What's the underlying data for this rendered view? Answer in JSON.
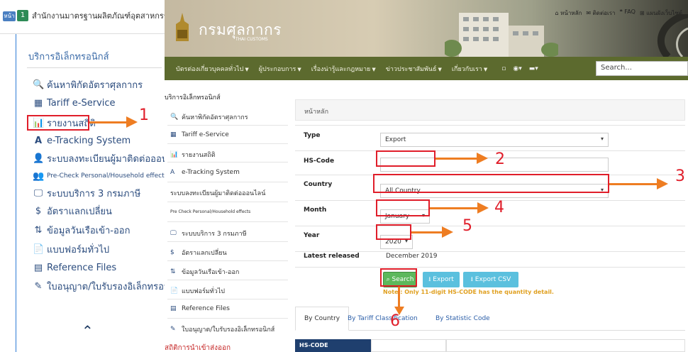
{
  "left_panel": {
    "home_chip": "หน้า",
    "num_chip": "1",
    "breadcrumb": "สำนักงานมาตรฐานผลิตภัณฑ์อุตสาหกรรม",
    "menu_title": "บริการอิเล็กทรอนิกส์",
    "items": [
      {
        "icon": "search-icon",
        "glyph": "🔍",
        "label": "ค้นหาพิกัดอัตราศุลกากร"
      },
      {
        "icon": "table-icon",
        "glyph": "▦",
        "label": "Tariff e-Service"
      },
      {
        "icon": "bar-chart-icon",
        "glyph": "📊",
        "label": "รายงานสถิติ"
      },
      {
        "icon": "tracking-icon",
        "glyph": "A",
        "label": "e-Tracking System"
      },
      {
        "icon": "user-register-icon",
        "glyph": "👤",
        "label": "ระบบลงทะเบียนผู้มาติดต่อออนไลน์"
      },
      {
        "icon": "personal-effects-icon",
        "glyph": "👥",
        "label": "Pre-Check Personal/Household effects"
      },
      {
        "icon": "monitor-icon",
        "glyph": "🖵",
        "label": "ระบบบริการ 3 กรมภาษี"
      },
      {
        "icon": "dollar-icon",
        "glyph": "$",
        "label": "อัตราแลกเปลี่ยน"
      },
      {
        "icon": "sort-icon",
        "glyph": "⇅",
        "label": "ข้อมูลวันเรือเข้า-ออก"
      },
      {
        "icon": "forms-icon",
        "glyph": "📄",
        "label": "แบบฟอร์มทั่วไป"
      },
      {
        "icon": "reference-icon",
        "glyph": "▤",
        "label": "Reference Files"
      },
      {
        "icon": "license-icon",
        "glyph": "✎",
        "label": "ใบอนุญาต/ใบรับรองอิเล็กทรอนิกส์"
      }
    ],
    "scroll_up": "⌃"
  },
  "site": {
    "logo_text": "กรมศุลกากร",
    "logo_sub": "THAI CUSTOMS",
    "top_links": [
      "หน้าหลัก",
      "ติดต่อเรา",
      "FAQ",
      "แผนผังเว็บไซต์"
    ],
    "nav_items": [
      "บัตรต่องเกี่ยวบุคคลทั่วไป",
      "ผู้ประกอบการ",
      "เรื่องน่ารู้และกฎหมาย",
      "ข่าวประชาสัมพันธ์",
      "เกี่ยวกับเรา"
    ],
    "search_placeholder": "Search...",
    "sidebar_title": "บริการอิเล็กทรอนิกส์",
    "sidebar_items": [
      {
        "glyph": "🔍",
        "label": "ค้นหาพิกัดอัตราศุลกากร"
      },
      {
        "glyph": "▦",
        "label": "Tariff e-Service"
      },
      {
        "glyph": "📊",
        "label": "รายงานสถิติ"
      },
      {
        "glyph": "A",
        "label": "e-Tracking System"
      },
      {
        "glyph": "",
        "label": "ระบบลงทะเบียนผู้มาติดต่อออนไลน์"
      },
      {
        "glyph": "",
        "label": "Pre Check Personal/Household effects"
      },
      {
        "glyph": "🖵",
        "label": "ระบบบริการ 3 กรมภาษี"
      },
      {
        "glyph": "$",
        "label": "อัตราแลกเปลี่ยน"
      },
      {
        "glyph": "⇅",
        "label": "ข้อมูลวันเรือเข้า-ออก"
      },
      {
        "glyph": "📄",
        "label": "แบบฟอร์มทั่วไป"
      },
      {
        "glyph": "▤",
        "label": "Reference Files"
      },
      {
        "glyph": "✎",
        "label": "ใบอนุญาต/ใบรับรองอิเล็กทรอนิกส์"
      }
    ],
    "sidebar_bottom": "สถิติการนำเข้าส่งออก",
    "crumb": "หน้าหลัก",
    "form": {
      "type_label": "Type",
      "type_value": "Export",
      "hs_label": "HS-Code",
      "hs_value": "",
      "country_label": "Country",
      "country_value": "All Country",
      "month_label": "Month",
      "month_value": "January",
      "year_label": "Year",
      "year_value": "2020",
      "latest_label": "Latest released",
      "latest_value": "December 2019"
    },
    "buttons": {
      "search": "Search",
      "export": "Export",
      "csv": "Export CSV"
    },
    "note": "Note : Only 11-digit HS-CODE has the quantity detail.",
    "tabs": [
      "By Country",
      "By Tariff Classification",
      "By Statistic Code"
    ],
    "table_header": "HS-CODE"
  },
  "annotations": [
    "1",
    "2",
    "3",
    "4",
    "5",
    "6"
  ],
  "colors": {
    "highlight": "#e01e2a",
    "arrow": "#ee7d22",
    "nav": "#5c6a2e",
    "search_btn": "#5cb85c",
    "export_btn": "#5bc0de",
    "table_header": "#1f3f6e"
  }
}
